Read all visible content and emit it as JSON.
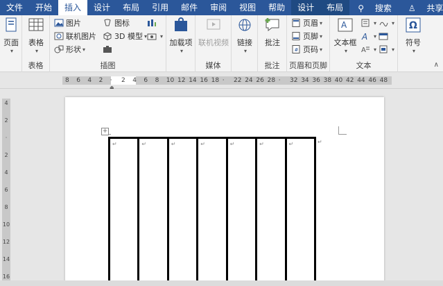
{
  "tabs": [
    "文件",
    "开始",
    "插入",
    "设计",
    "布局",
    "引用",
    "邮件",
    "审阅",
    "视图",
    "帮助",
    "设计",
    "布局"
  ],
  "active_tab": "插入",
  "tab_right": {
    "search": "搜索",
    "share": "共享"
  },
  "ribbon": {
    "pages": {
      "label": "页面"
    },
    "table": {
      "label": "表格",
      "group": "表格"
    },
    "illustrations": {
      "picture": "图片",
      "online_picture": "联机图片",
      "shapes": "形状",
      "icons": "图标",
      "model3d": "3D 模型",
      "group": "插图"
    },
    "addins": {
      "label": "加载项"
    },
    "media": {
      "online_video": "联机视频",
      "group": "媒体"
    },
    "link": {
      "label": "链接"
    },
    "comments": {
      "label": "批注",
      "group": "批注"
    },
    "header_footer": {
      "header": "页眉",
      "footer": "页脚",
      "page_number": "页码",
      "group": "页眉和页脚"
    },
    "text": {
      "textbox": "文本框",
      "group": "文本"
    },
    "symbols": {
      "label": "符号"
    }
  },
  "ruler_ticks": [
    "8",
    "6",
    "4",
    "2",
    "",
    "2",
    "4",
    "6",
    "8",
    "10",
    "12",
    "14",
    "16",
    "18",
    "",
    "22",
    "24",
    "26",
    "28",
    "",
    "32",
    "34",
    "36",
    "38",
    "40",
    "42",
    "44",
    "46",
    "48"
  ],
  "vruler_ticks": [
    "4",
    "2",
    "",
    "2",
    "4",
    "6",
    "8",
    "10",
    "12",
    "14",
    "16"
  ],
  "table": {
    "columns": 7
  }
}
